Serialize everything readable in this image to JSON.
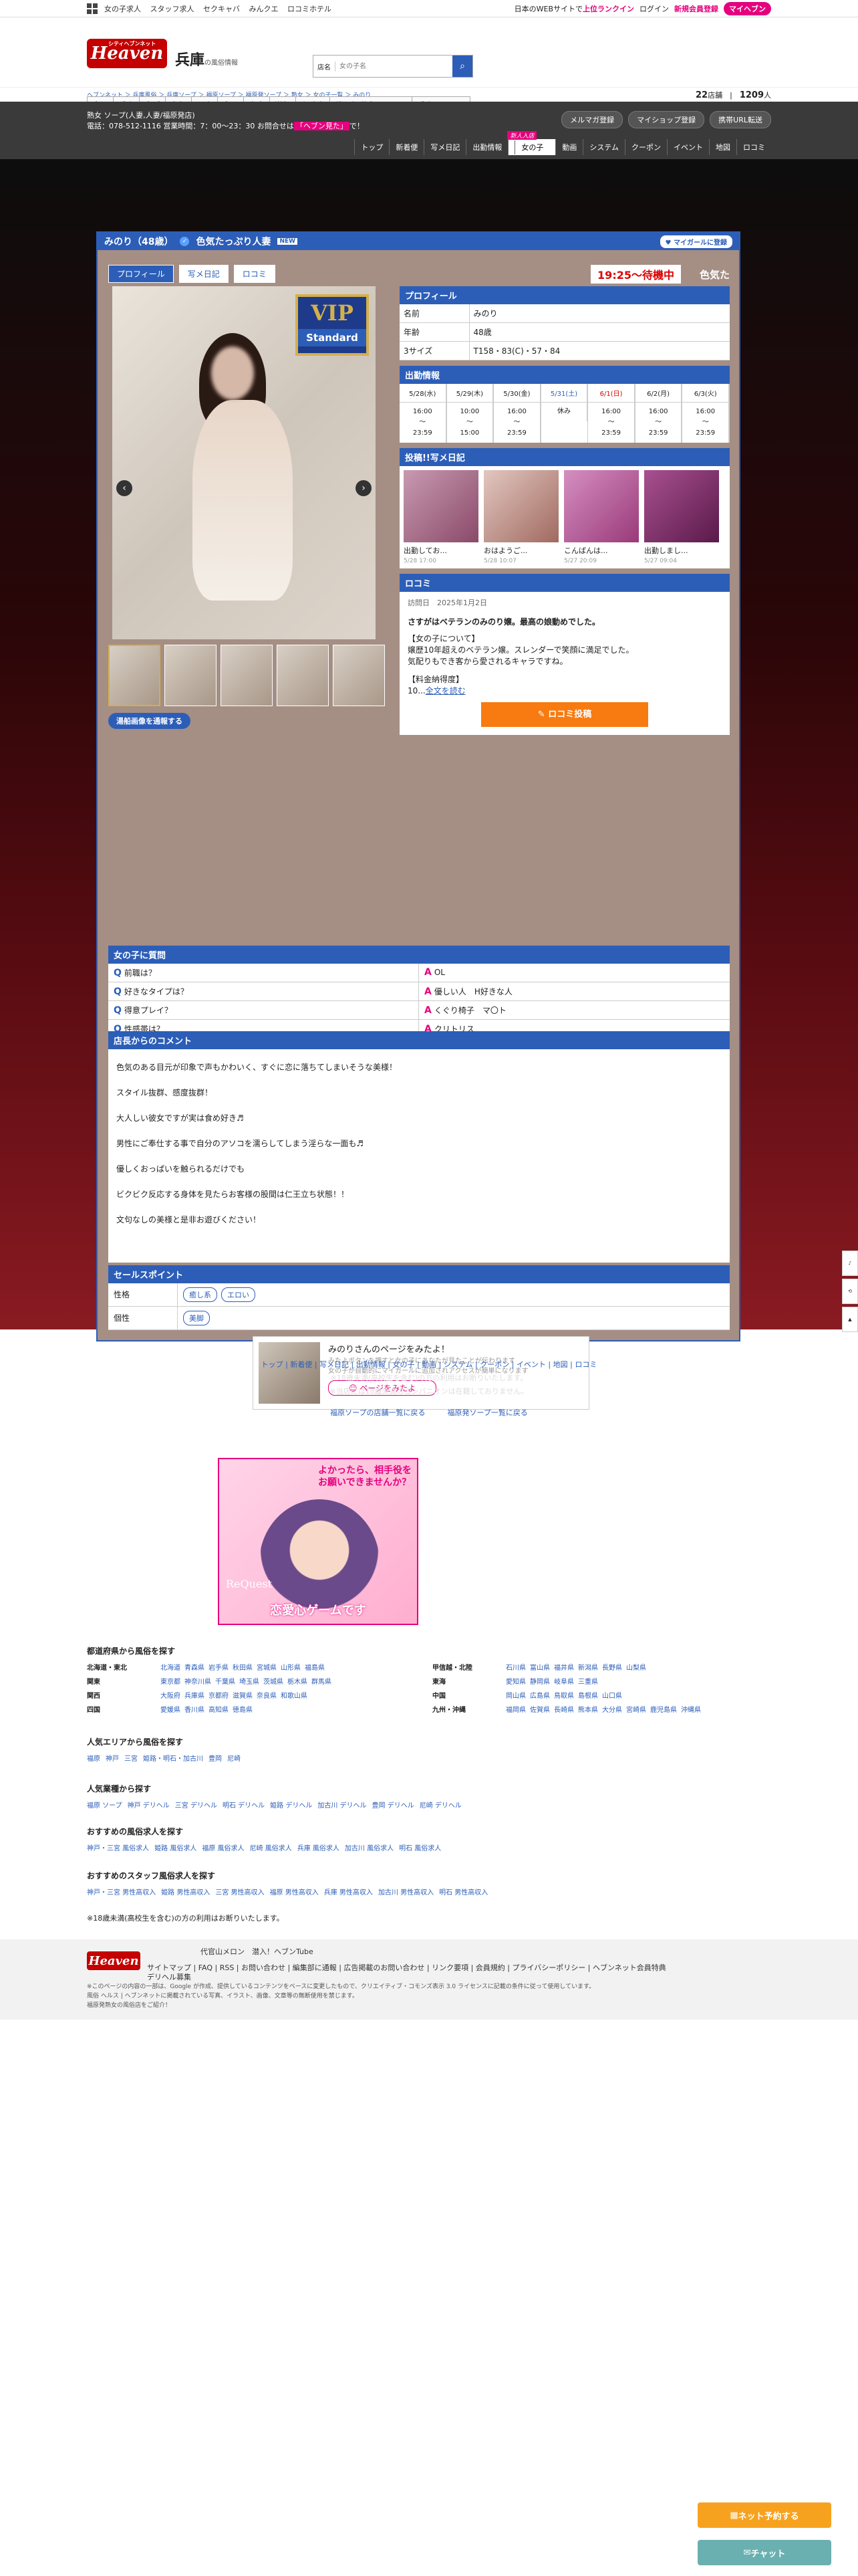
{
  "topbar": {
    "links": [
      "女の子求人",
      "スタッフ求人",
      "セクキャバ",
      "みんクエ",
      "ロコミホテル"
    ],
    "notice_pre": "日本のWEBサイトで",
    "notice_hl": "上位ランクイン",
    "login": "ログイン",
    "register": "新規会員登録",
    "myheaven": "マイヘブン"
  },
  "header": {
    "logo": "Heaven",
    "logo_sub": "シティヘブンネット",
    "region": "兵庫",
    "region_sub": "の風俗情報",
    "search_label": "店名",
    "search_placeholder": "女の子名",
    "nav": [
      "全国",
      "兵庫",
      "大阪",
      "京都",
      "岡山",
      "鳥取",
      "奈良",
      "滋賀",
      "和歌山",
      "他の都道府県を選ぶ",
      "兵庫のエリア"
    ]
  },
  "crumb": {
    "text": "ヘブンネット ＞ 兵庫風俗 ＞ 兵庫ソープ ＞ 福原ソープ ＞ 福原発ソープ ＞ 熟女 ＞ 女の子一覧 ＞ みのり",
    "shops": "22",
    "shops_unit": "店舗",
    "girls": "1209",
    "girls_unit": "人"
  },
  "shop": {
    "line1": "熟女 ソープ(人妻,人妻/福原発店)",
    "line2_pre": "電話：078-512-1116 営業時間：7：00〜23：30 お問合せは",
    "line2_tag": "「ヘブン見た」",
    "line2_post": "で！",
    "btns": [
      "メルマガ登録",
      "マイショップ登録",
      "携帯URL転送"
    ],
    "tabs": [
      "トップ",
      "新着便",
      "写メ日記",
      "出勤情報",
      "女の子",
      "動画",
      "システム",
      "クーポン",
      "イベント",
      "地図",
      "ロコミ"
    ],
    "new_tag": "新人入店"
  },
  "girl": {
    "name": "みのり（48歳）",
    "catch": "色気たっぷり人妻",
    "new_label": "NEW",
    "fav": "マイガールに登録",
    "tabs": [
      "プロフィール",
      "写メ日記",
      "ロコミ"
    ],
    "wait": "19:25〜待機中",
    "catch2": "色気た",
    "vip1": "VIP",
    "vip2": "Standard",
    "bath_btn": "湯船画像を通報する"
  },
  "profile": {
    "title": "プロフィール",
    "rows": [
      {
        "k": "名前",
        "v": "みのり"
      },
      {
        "k": "年齢",
        "v": "48歳"
      },
      {
        "k": "3サイズ",
        "v": "T158・83(C)・57・84"
      }
    ]
  },
  "schedule": {
    "title": "出勤情報",
    "days": [
      "5/28(水)",
      "5/29(木)",
      "5/30(金)",
      "5/31(土)",
      "6/1(日)",
      "6/2(月)",
      "6/3(火)"
    ],
    "times": [
      "16:00\n〜\n23:59",
      "10:00\n〜\n15:00",
      "16:00\n〜\n23:59",
      "休み",
      "16:00\n〜\n23:59",
      "16:00\n〜\n23:59",
      "16:00\n〜\n23:59"
    ]
  },
  "diary": {
    "title": "投稿!!写メ日記",
    "items": [
      {
        "t": "出勤してお...",
        "d": "5/28 17:00"
      },
      {
        "t": "おはようご...",
        "d": "5/28 10:07"
      },
      {
        "t": "こんばんは...",
        "d": "5/27 20:09"
      },
      {
        "t": "出勤しまし...",
        "d": "5/27 09:04"
      }
    ]
  },
  "kuchikomi": {
    "title": "ロコミ",
    "date_label": "訪問日",
    "date": "2025年1月2日",
    "headline": "さすがはベテランのみのり嬢。最高の娘動めでした。",
    "body1": "【女の子について】",
    "body2": "嬢歴10年超えのベテラン嬢。スレンダーで笑顔に満足でした。",
    "body3": "気配りもでき客から愛されるキャラですね。",
    "body4": "【料金納得度】",
    "body5": "10...",
    "more": "全文を読む",
    "post": "✎ ロコミ投稿"
  },
  "qa": {
    "title": "女の子に質問",
    "items": [
      {
        "q": "前職は？",
        "a": "OL"
      },
      {
        "q": "好きなタイプは？",
        "a": "優しい人　H好きな人"
      },
      {
        "q": "得意プレイ？",
        "a": "くぐり椅子　マ〇ト"
      },
      {
        "q": "性感帯は？",
        "a": "クリトリス"
      }
    ]
  },
  "comment": {
    "title": "店長からのコメント",
    "paras": [
      "色気のある目元が印象で声もかわいく、すぐに恋に落ちてしまいそうな美様！",
      "スタイル抜群、感度抜群！",
      "大人しい彼女ですが実は食め好き♬",
      "男性にご奉仕する事で自分のアソコを濡らしてしまう淫らな一面も♬",
      "優しくおっぱいを触られるだけでも",
      "ビクビク反応する身体を見たらお客様の股間は仁王立ち状態！！",
      "文句なしの美様と是非お遊びください！"
    ]
  },
  "sales": {
    "title": "セールスポイント",
    "rows": [
      {
        "k": "性格",
        "v": [
          "癒し系",
          "エロい"
        ]
      },
      {
        "k": "個性",
        "v": [
          "美脚"
        ]
      }
    ]
  },
  "pagecard": {
    "title": "みのりさんのページをみたよ！",
    "sub1": "みたよボタンを押すと女の子にあなたが見たことが伝わります",
    "sub2": "女の子が自動的にマイガールに追加されアクセスが簡単になります",
    "btn": "ページをみたよ"
  },
  "footnav": {
    "links": "トップ | 新着便 | 写メ日記 | 出勤情報 | 女の子 | 動画 | システム | クーポン | イベント | 地図 | ロコミ",
    "note1": "※18歳未満(高校生を含む)の方の利用はお断りいたします。",
    "note2": "※当店には18歳未満のコンパニオンは在籍しておりません。",
    "l1": "福原ソープの店舗一覧に戻る",
    "l2": "福原発ソープ一覧に戻る"
  },
  "banner": {
    "top": "よかったら、相手役をお願いできませんか？",
    "rq": "ReQuest",
    "bottom": "恋愛心ゲームです"
  },
  "prefs": {
    "title": "都道府県から風俗を探す",
    "left": [
      {
        "k": "北海道・東北",
        "v": [
          "北海道",
          "青森県",
          "岩手県",
          "秋田県",
          "宮城県",
          "山形県",
          "福島県"
        ]
      },
      {
        "k": "関東",
        "v": [
          "東京都",
          "神奈川県",
          "千葉県",
          "埼玉県",
          "茨城県",
          "栃木県",
          "群馬県"
        ]
      },
      {
        "k": "関西",
        "v": [
          "大阪府",
          "兵庫県",
          "京都府",
          "滋賀県",
          "奈良県",
          "和歌山県"
        ]
      },
      {
        "k": "四国",
        "v": [
          "愛媛県",
          "香川県",
          "高知県",
          "徳島県"
        ]
      }
    ],
    "right": [
      {
        "k": "甲信越・北陸",
        "v": [
          "石川県",
          "富山県",
          "福井県",
          "新潟県",
          "長野県",
          "山梨県"
        ]
      },
      {
        "k": "東海",
        "v": [
          "愛知県",
          "静岡県",
          "岐阜県",
          "三重県"
        ]
      },
      {
        "k": "中国",
        "v": [
          "岡山県",
          "広島県",
          "鳥取県",
          "島根県",
          "山口県"
        ]
      },
      {
        "k": "九州・沖縄",
        "v": [
          "福岡県",
          "佐賀県",
          "長崎県",
          "熊本県",
          "大分県",
          "宮崎県",
          "鹿児島県",
          "沖縄県"
        ]
      }
    ]
  },
  "area": {
    "title": "人気エリアから風俗を探す",
    "items": [
      "福原",
      "神戸",
      "三宮",
      "姫路・明石・加古川",
      "豊岡",
      "尼崎"
    ]
  },
  "genre": {
    "title": "人気業種から探す",
    "items": [
      "福原 ソープ",
      "神戸 デリヘル",
      "三宮 デリヘル",
      "明石 デリヘル",
      "姫路 デリヘル",
      "加古川 デリヘル",
      "豊岡 デリヘル",
      "尼崎 デリヘル"
    ]
  },
  "jobs": {
    "title": "おすすめの風俗求人を探す",
    "items": [
      "神戸・三宮 風俗求人",
      "姫路 風俗求人",
      "福原 風俗求人",
      "尼崎 風俗求人",
      "兵庫 風俗求人",
      "加古川 風俗求人",
      "明石 風俗求人"
    ]
  },
  "staff": {
    "title": "おすすめのスタッフ風俗求人を探す",
    "items": [
      "神戸・三宮 男性高収入",
      "姫路 男性高収入",
      "三宮 男性高収入",
      "福原 男性高収入",
      "兵庫 男性高収入",
      "加古川 男性高収入",
      "明石 男性高収入"
    ]
  },
  "age_note": "※18歳未満(高校生を含む)の方の利用はお断りいたします。",
  "footer": {
    "logo": "Heaven",
    "top_links": "代官山メロン　潜入！ヘブンTube",
    "links": "サイトマップ | FAQ | RSS | お問い合わせ | 編集部に通報 | 広告掲載のお問い合わせ | リンク要項 | 会員規約 | プライバシーポリシー | ヘブンネット会員特典",
    "links2": "デリヘル募集",
    "note1": "※このページの内容の一部は、Google が作成、提供しているコンテンツをベースに変更したもので、クリエイティブ・コモンズ表示 3.0 ライセンスに記載の条件に従って使用しています。",
    "note2": "風俗 ヘルス | ヘブンネットに掲載されている写真、イラスト、画像、文章等の無断使用を禁じます。",
    "note3": "福原発熟女の風俗店をご紹介！"
  },
  "floating": {
    "net": "ネット予約する",
    "chat": "チャット"
  }
}
